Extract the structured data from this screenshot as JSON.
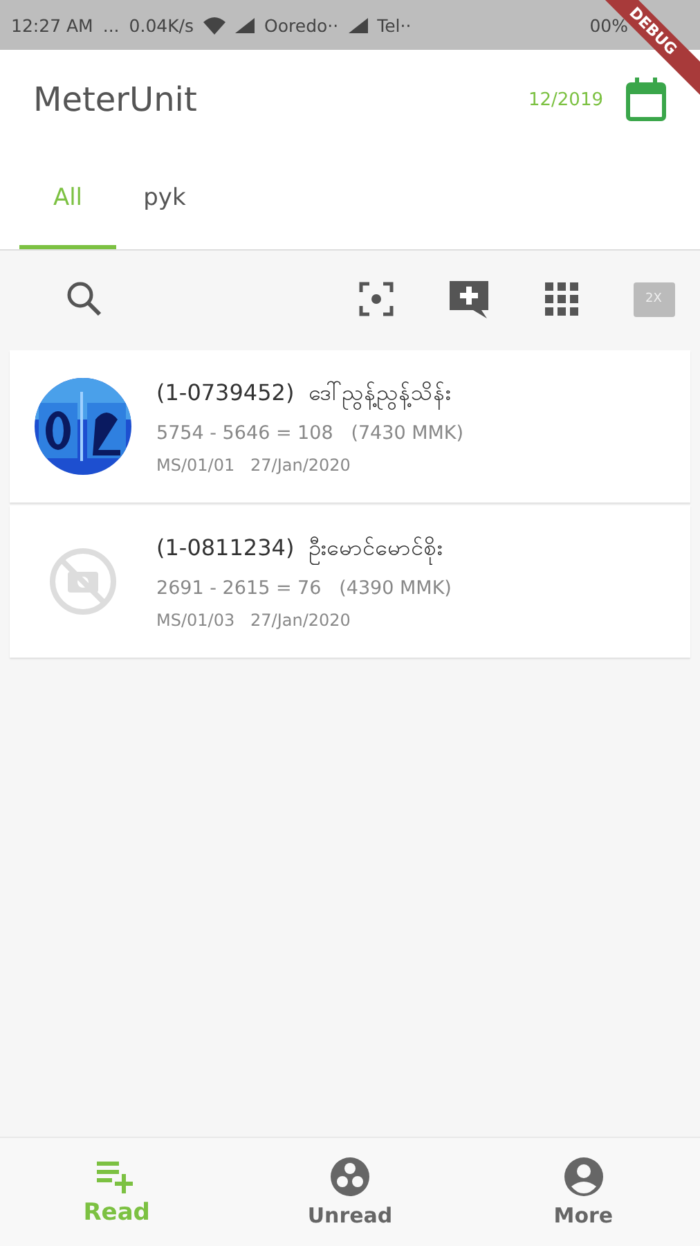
{
  "status_bar": {
    "time": "12:27 AM",
    "dots": "...",
    "speed": "0.04K/s",
    "carrier_1": "Ooredo··",
    "carrier_2": "Tel··",
    "battery": "00%"
  },
  "debug_banner": "DEBUG",
  "app_bar": {
    "title": "MeterUnit",
    "period": "12/2019"
  },
  "tabs": [
    {
      "label": "All",
      "selected": true
    },
    {
      "label": "pyk",
      "selected": false
    }
  ],
  "toolbar": {
    "zoom_label": "2X"
  },
  "readings": [
    {
      "title": "(1-0739452)  ဒေါ်ညွန့်ညွန့်သိန်း",
      "calc": "5754 - 5646 = 108   (7430 MMK)",
      "meta": "MS/01/01   27/Jan/2020",
      "kind": "picture"
    },
    {
      "title": "(1-0811234)  ဦးမောင်မောင်စိုး",
      "calc": "2691 - 2615 = 76   (4390 MMK)",
      "meta": "MS/01/03   27/Jan/2020",
      "kind": "no_photo"
    }
  ],
  "bottom_nav": [
    {
      "label": "Read",
      "kind": "read",
      "selected": true
    },
    {
      "label": "Unread",
      "kind": "unread",
      "selected": false
    },
    {
      "label": "More",
      "kind": "more",
      "selected": false
    }
  ]
}
